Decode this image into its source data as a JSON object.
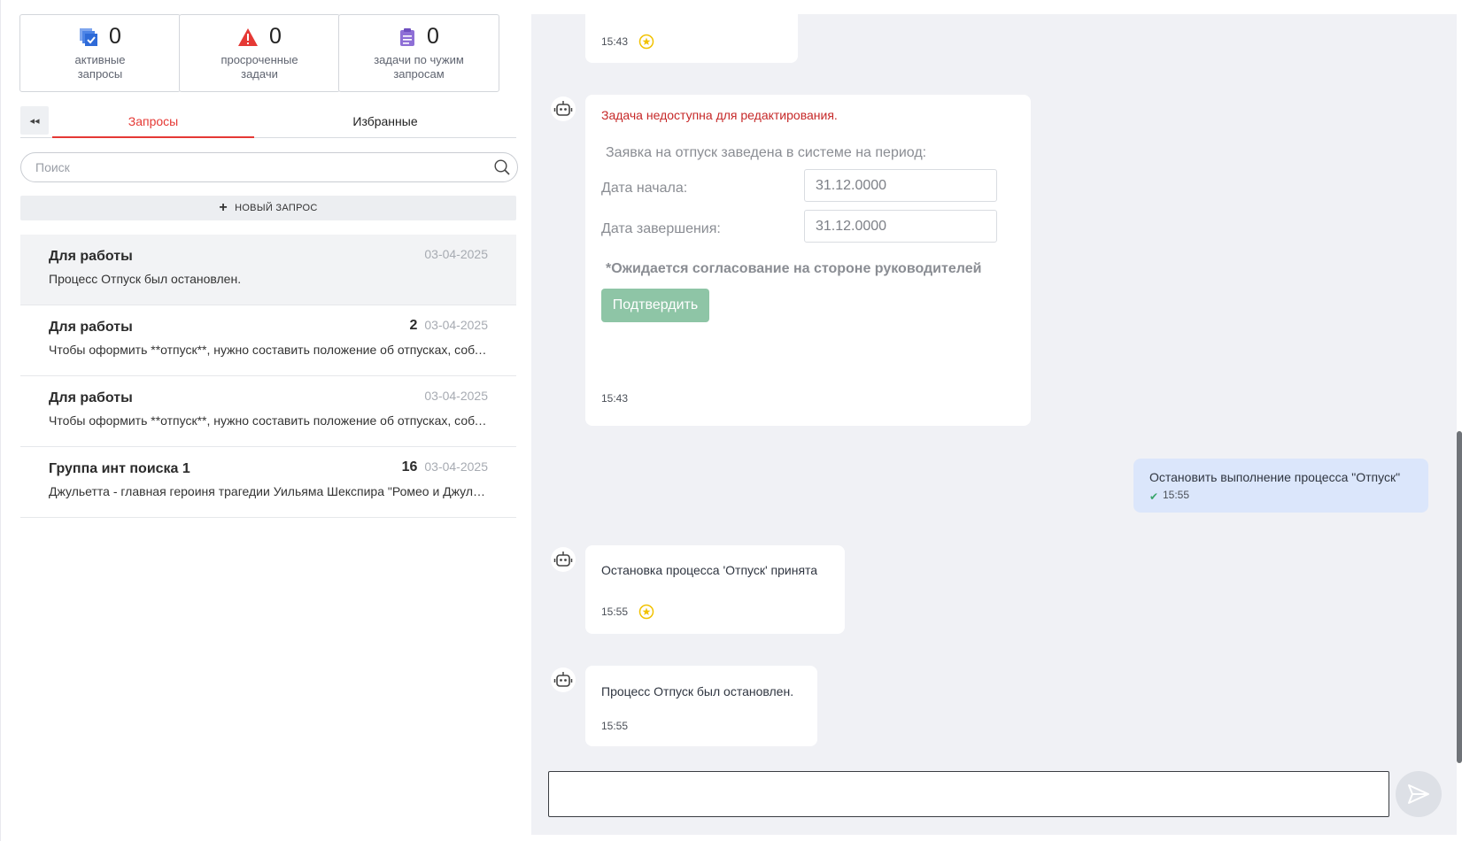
{
  "stats": [
    {
      "count": "0",
      "label_line1": "активные",
      "label_line2": "запросы",
      "icon": "active-requests-icon",
      "color": "#2f6bd8"
    },
    {
      "count": "0",
      "label_line1": "просроченные",
      "label_line2": "задачи",
      "icon": "warning-icon",
      "color": "#e53935"
    },
    {
      "count": "0",
      "label_line1": "задачи по чужим",
      "label_line2": "запросам",
      "icon": "clipboard-icon",
      "color": "#8e6fd6"
    }
  ],
  "tabs": {
    "collapse_glyph": "◂◂",
    "requests": "Запросы",
    "favorites": "Избранные"
  },
  "search": {
    "placeholder": "Поиск",
    "value": ""
  },
  "new_request": {
    "label": "НОВЫЙ ЗАПРОС"
  },
  "conversations": [
    {
      "title": "Для работы",
      "preview": "Процесс Отпуск был остановлен.",
      "badge": "",
      "date": "03-04-2025"
    },
    {
      "title": "Для работы",
      "preview": "Чтобы оформить **отпуск**, нужно составить положение об отпусках, соблюдая требования",
      "badge": "2",
      "date": "03-04-2025"
    },
    {
      "title": "Для работы",
      "preview": "Чтобы оформить **отпуск**, нужно составить положение об отпусках, соблюдая требования",
      "badge": "",
      "date": "03-04-2025"
    },
    {
      "title": "Группа инт поиска 1",
      "preview": "Джульетта - главная героиня трагедии Уильяма Шекспира \"Ромео и Джульетта\"",
      "badge": "16",
      "date": "03-04-2025"
    }
  ],
  "messages": {
    "m1": {
      "time": "15:43"
    },
    "m2": {
      "error": "Задача недоступна для редактирования.",
      "intro": "Заявка на отпуск заведена в системе на период:",
      "start_label": "Дата начала:",
      "start_value": "31.12.0000",
      "end_label": "Дата завершения:",
      "end_value": "31.12.0000",
      "note": "*Ожидается согласование на стороне руководителей",
      "confirm_label": "Подтвердить",
      "time": "15:43"
    },
    "u1": {
      "text": "Остановить выполнение процесса \"Отпуск\"",
      "time": "15:55"
    },
    "m3": {
      "text": "Остановка процесса 'Отпуск' принята",
      "time": "15:55"
    },
    "m4": {
      "text": "Процесс Отпуск был остановлен.",
      "time": "15:55"
    }
  },
  "composer": {
    "placeholder": "",
    "value": ""
  },
  "colors": {
    "accent": "#e53935",
    "confirm": "#8ec5a6",
    "user_bubble": "#dbe6fb",
    "chat_bg": "#f0f1f5"
  }
}
